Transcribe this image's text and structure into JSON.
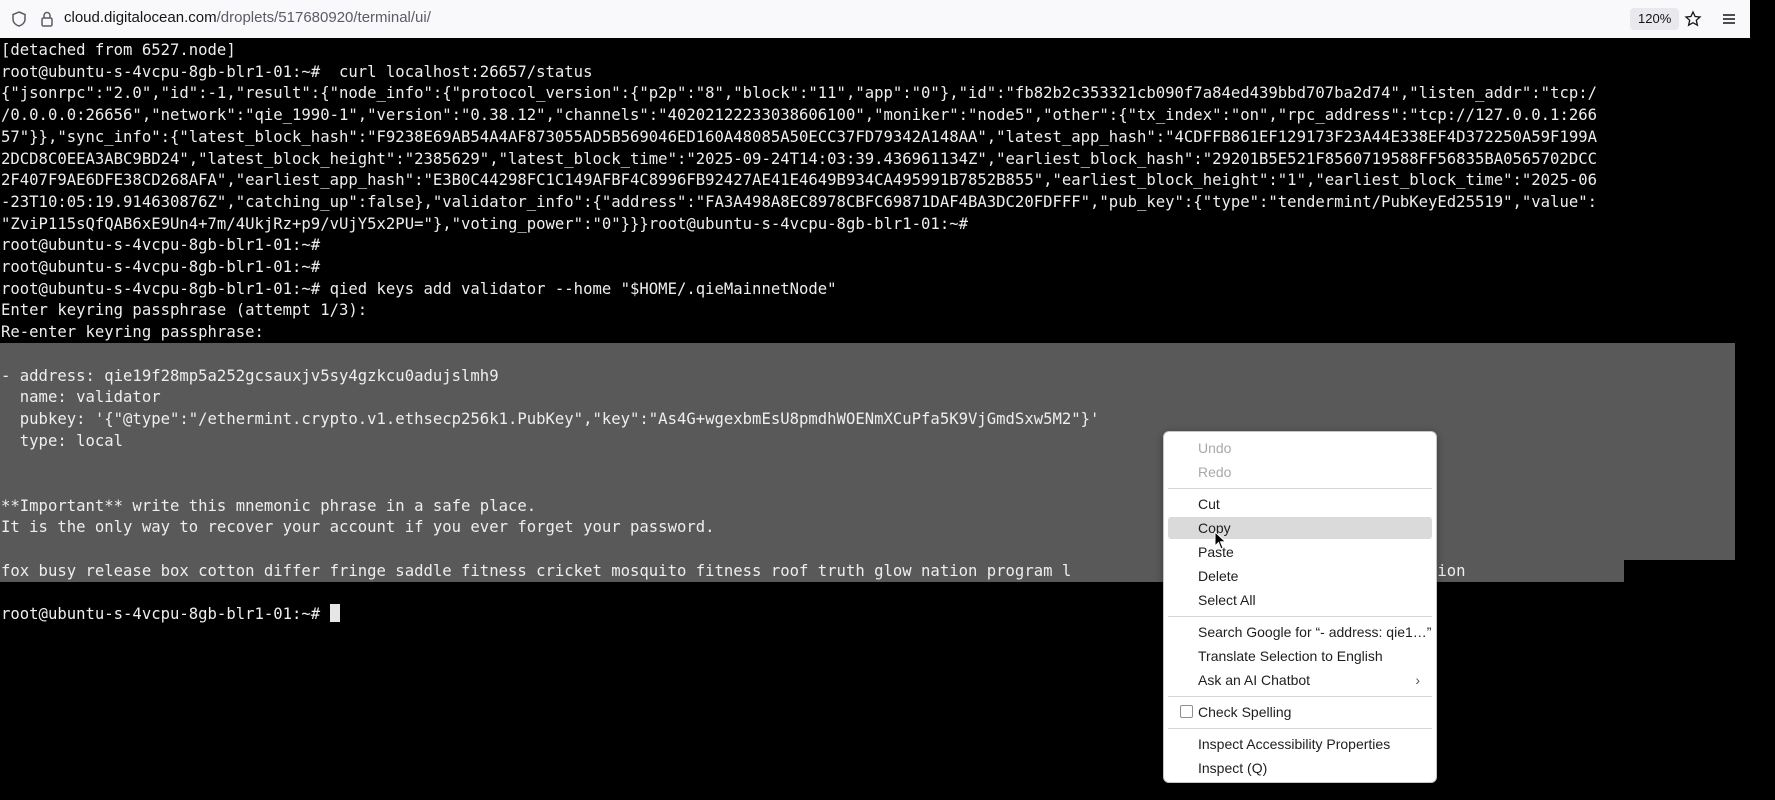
{
  "browser": {
    "url_host": "cloud.digitalocean.com",
    "url_path": "/droplets/517680920/terminal/ui/",
    "zoom": "120%",
    "icons": [
      "shield-icon",
      "lock-icon",
      "star-icon",
      "hamburger-menu-icon"
    ]
  },
  "terminal": {
    "lines": [
      "[detached from 6527.node]",
      "root@ubuntu-s-4vcpu-8gb-blr1-01:~#  curl localhost:26657/status",
      "{\"jsonrpc\":\"2.0\",\"id\":-1,\"result\":{\"node_info\":{\"protocol_version\":{\"p2p\":\"8\",\"block\":\"11\",\"app\":\"0\"},\"id\":\"fb82b2c353321cb090f7a84ed439bbd707ba2d74\",\"listen_addr\":\"tcp:/",
      "/0.0.0.0:26656\",\"network\":\"qie_1990-1\",\"version\":\"0.38.12\",\"channels\":\"40202122233038606100\",\"moniker\":\"node5\",\"other\":{\"tx_index\":\"on\",\"rpc_address\":\"tcp://127.0.0.1:266",
      "57\"}},\"sync_info\":{\"latest_block_hash\":\"F9238E69AB54A4AF873055AD5B569046ED160A48085A50ECC37FD79342A148AA\",\"latest_app_hash\":\"4CDFFB861EF129173F23A44E338EF4D372250A59F199A",
      "2DCD8C0EEA3ABC9BD24\",\"latest_block_height\":\"2385629\",\"latest_block_time\":\"2025-09-24T14:03:39.436961134Z\",\"earliest_block_hash\":\"29201B5E521F8560719588FF56835BA0565702DCC",
      "2F407F9AE6DFE38CD268AFA\",\"earliest_app_hash\":\"E3B0C44298FC1C149AFBF4C8996FB92427AE41E4649B934CA495991B7852B855\",\"earliest_block_height\":\"1\",\"earliest_block_time\":\"2025-06",
      "-23T10:05:19.914630876Z\",\"catching_up\":false},\"validator_info\":{\"address\":\"FA3A498A8EC8978CBFC69871DAF4BA3DC20FDFFF\",\"pub_key\":{\"type\":\"tendermint/PubKeyEd25519\",\"value\":",
      "\"ZviP115sQfQAB6xE9Un4+7m/4UkjRz+p9/vUjY5x2PU=\"},\"voting_power\":\"0\"}}}root@ubuntu-s-4vcpu-8gb-blr1-01:~#",
      "root@ubuntu-s-4vcpu-8gb-blr1-01:~#",
      "root@ubuntu-s-4vcpu-8gb-blr1-01:~#",
      "root@ubuntu-s-4vcpu-8gb-blr1-01:~# qied keys add validator --home \"$HOME/.qieMainnetNode\"",
      "Enter keyring passphrase (attempt 1/3):",
      "Re-enter keyring passphrase:",
      "",
      "- address: qie19f28mp5a252gcsauxjv5sy4gzkcu0adujslmh9",
      "  name: validator",
      "  pubkey: '{\"@type\":\"/ethermint.crypto.v1.ethsecp256k1.PubKey\",\"key\":\"As4G+wgexbmEsU8pmdhWOENmXCuPfa5K9VjGmdSxw5M2\"}'",
      "  type: local",
      "",
      "",
      "**Important** write this mnemonic phrase in a safe place.",
      "It is the only way to recover your account if you ever forget your password.",
      "",
      "fox busy release box cotton differ fringe saddle fitness cricket mosquito fitness roof truth glow nation program l                        iver share caution",
      "",
      "root@ubuntu-s-4vcpu-8gb-blr1-01:~# "
    ]
  },
  "context_menu": {
    "undo": "Undo",
    "redo": "Redo",
    "cut": "Cut",
    "copy": "Copy",
    "paste": "Paste",
    "delete": "Delete",
    "select_all": "Select All",
    "search": "Search Google for “- address: qie1…”",
    "translate": "Translate Selection to English",
    "chatbot": "Ask an AI Chatbot",
    "check_spelling": "Check Spelling",
    "inspect_accessibility": "Inspect Accessibility Properties",
    "inspect": "Inspect (Q)"
  }
}
